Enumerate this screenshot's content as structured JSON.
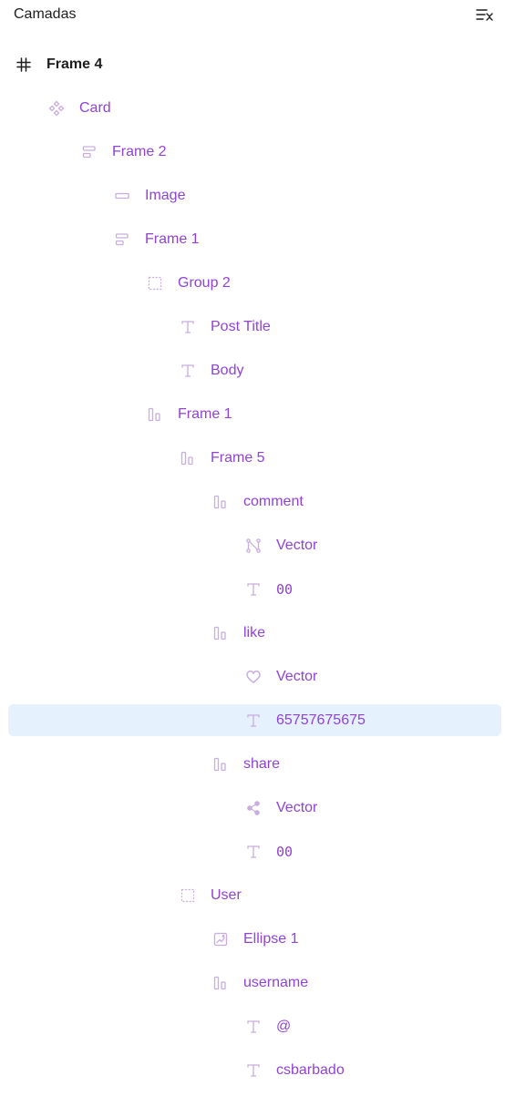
{
  "panel": {
    "title": "Camadas",
    "collapse_icon": "collapse-list-icon"
  },
  "colors": {
    "layer_text": "#9142d8",
    "root_text": "#1e1e1e",
    "icon": "#c9addf",
    "selected_bg": "#e5f2fd"
  },
  "layers": [
    {
      "label": "Frame 4",
      "icon": "hash-icon",
      "depth": 0,
      "root": true
    },
    {
      "label": "Card",
      "icon": "component-icon",
      "depth": 1
    },
    {
      "label": "Frame 2",
      "icon": "auto-layout-vertical-icon",
      "depth": 2
    },
    {
      "label": "Image",
      "icon": "rectangle-icon",
      "depth": 3
    },
    {
      "label": "Frame 1",
      "icon": "auto-layout-vertical-icon",
      "depth": 3
    },
    {
      "label": "Group 2",
      "icon": "group-icon",
      "depth": 4
    },
    {
      "label": "Post Title",
      "icon": "text-icon",
      "depth": 5
    },
    {
      "label": "Body",
      "icon": "text-icon",
      "depth": 5
    },
    {
      "label": "Frame 1",
      "icon": "auto-layout-horizontal-icon",
      "depth": 4
    },
    {
      "label": "Frame 5",
      "icon": "auto-layout-horizontal-icon",
      "depth": 5
    },
    {
      "label": "comment",
      "icon": "auto-layout-horizontal-icon",
      "depth": 6
    },
    {
      "label": "Vector",
      "icon": "vector-path-icon",
      "depth": 7
    },
    {
      "label": "00",
      "icon": "text-icon",
      "depth": 7,
      "mono": true
    },
    {
      "label": "like",
      "icon": "auto-layout-horizontal-icon",
      "depth": 6
    },
    {
      "label": "Vector",
      "icon": "heart-icon",
      "depth": 7
    },
    {
      "label": "65757675675",
      "icon": "text-icon",
      "depth": 7,
      "selected": true
    },
    {
      "label": "share",
      "icon": "auto-layout-horizontal-icon",
      "depth": 6
    },
    {
      "label": "Vector",
      "icon": "share-icon",
      "depth": 7
    },
    {
      "label": "00",
      "icon": "text-icon",
      "depth": 7,
      "mono": true
    },
    {
      "label": "User",
      "icon": "group-icon",
      "depth": 5
    },
    {
      "label": "Ellipse 1",
      "icon": "image-fill-icon",
      "depth": 6
    },
    {
      "label": "username",
      "icon": "auto-layout-horizontal-icon",
      "depth": 6
    },
    {
      "label": "@",
      "icon": "text-icon",
      "depth": 7
    },
    {
      "label": "csbarbado",
      "icon": "text-icon",
      "depth": 7
    }
  ]
}
